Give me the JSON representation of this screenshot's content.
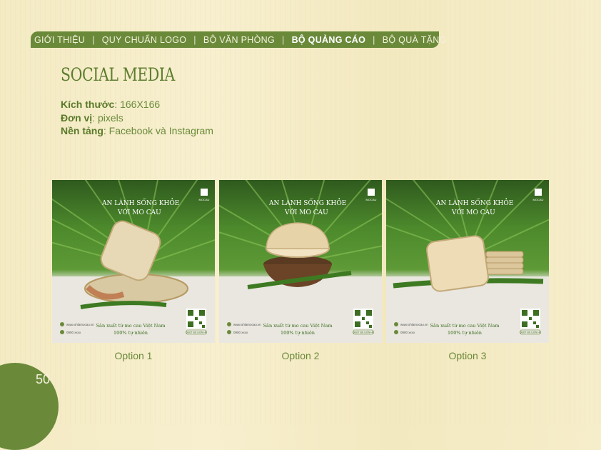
{
  "nav": {
    "items": [
      {
        "label": "GIỚI THIỆU"
      },
      {
        "label": "QUY CHUẨN LOGO"
      },
      {
        "label": "BỘ VĂN PHÒNG"
      },
      {
        "label": "BỘ QUẢNG CÁO"
      },
      {
        "label": "BỘ QUÀ TẶNG"
      }
    ],
    "active": "BỘ QUẢNG CÁO",
    "separator": "|"
  },
  "section_title": "SOCIAL MEDIA",
  "specs": {
    "size_label": "Kích thước",
    "size_value": ": 166X166",
    "unit_label": "Đơn vị",
    "unit_value": ": pixels",
    "platform_label": "Nền tảng",
    "platform_value": ": Facebook và Instagram"
  },
  "cards": [
    {
      "caption": "Option 1",
      "headline_1": "AN LÀNH SỐNG KHỎE",
      "headline_2": "VỚI MO CAU",
      "tagline_1": "Sản xuất từ mo cau Việt Nam",
      "tagline_2": "100% tự nhiên",
      "website": "www.ohlamocau.vn",
      "phone": "0900 xxxx",
      "logo_text": "MOCAU",
      "qr_caption": "QUÉT ĐỂ LIÊN HỆ"
    },
    {
      "caption": "Option 2",
      "headline_1": "AN LÀNH SỐNG KHỎE",
      "headline_2": "VỚI MO CAU",
      "tagline_1": "Sản xuất từ mo cau Việt Nam",
      "tagline_2": "100% tự nhiên",
      "website": "www.ohlamocau.vn",
      "phone": "0900 xxxx",
      "logo_text": "MOCAU",
      "qr_caption": "QUÉT ĐỂ LIÊN HỆ"
    },
    {
      "caption": "Option 3",
      "headline_1": "AN LÀNH SỐNG KHỎE",
      "headline_2": "VỚI MO CAU",
      "tagline_1": "Sản xuất từ mo cau Việt Nam",
      "tagline_2": "100% tự nhiên",
      "website": "www.ohlamocau.vn",
      "phone": "0900 xxxx",
      "logo_text": "MOCAU",
      "qr_caption": "QUÉT ĐỂ LIÊN HỆ"
    }
  ],
  "page_number": "50",
  "colors": {
    "accent": "#6a8a3a",
    "background": "#f5edc9",
    "text_light": "#f4f0dc"
  }
}
